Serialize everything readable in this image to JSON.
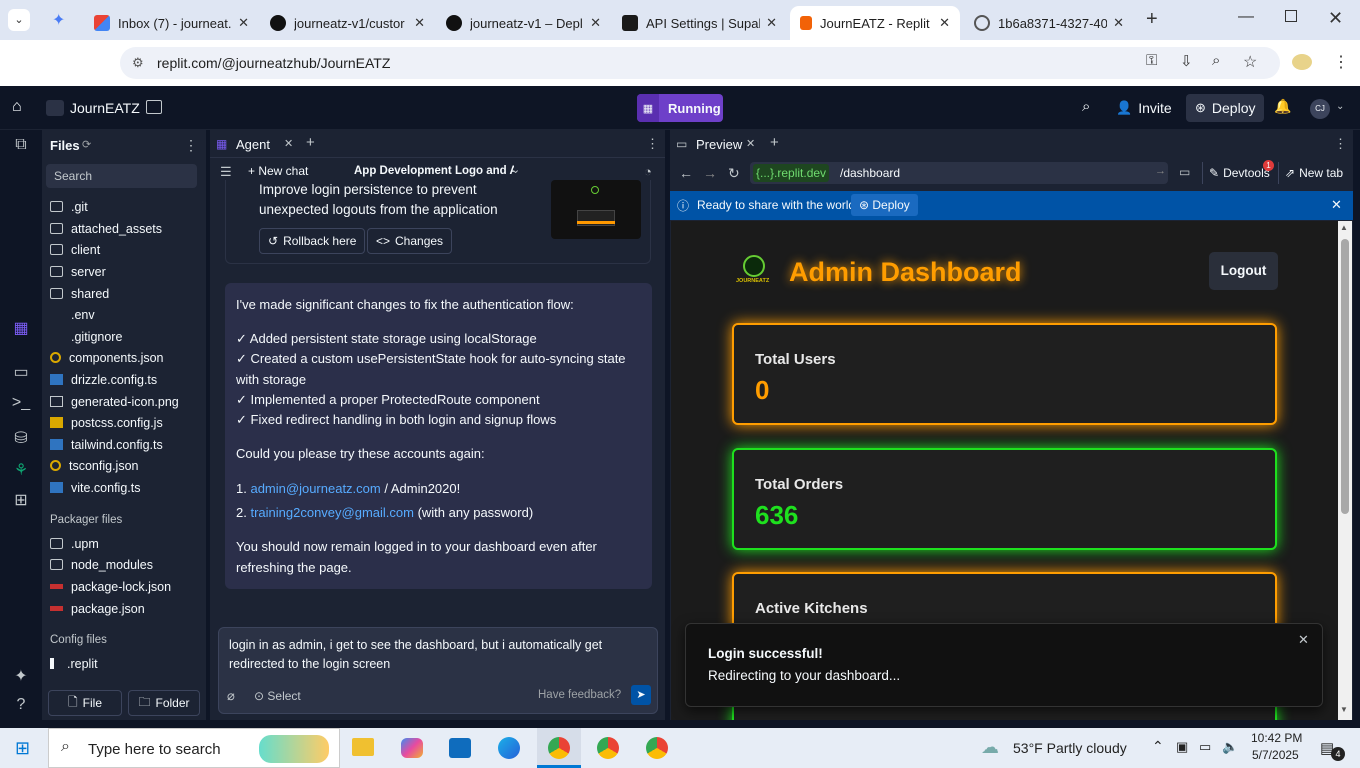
{
  "browser": {
    "tabs": [
      {
        "title": "Inbox (7) - journeat...",
        "icon": "gmail-icon"
      },
      {
        "title": "journeatz-v1/custor",
        "icon": "github-icon"
      },
      {
        "title": "journeatz-v1 – Depl",
        "icon": "vercel-icon"
      },
      {
        "title": "API Settings | Supab",
        "icon": "supabase-icon"
      },
      {
        "title": "JournEATZ - Replit",
        "icon": "replit-icon"
      },
      {
        "title": "1b6a8371-4327-40",
        "icon": "globe-icon"
      }
    ],
    "url": "replit.com/@journeatzhub/JournEATZ"
  },
  "replit": {
    "project_name": "JournEATZ",
    "run_status": "Running",
    "invite_label": "Invite",
    "deploy_label": "Deploy",
    "avatar_initials": "CJ"
  },
  "files": {
    "title": "Files",
    "search_placeholder": "Search",
    "items": [
      ".git",
      "attached_assets",
      "client",
      "server",
      "shared",
      ".env",
      ".gitignore",
      "components.json",
      "drizzle.config.ts",
      "generated-icon.png",
      "postcss.config.js",
      "tailwind.config.ts",
      "tsconfig.json",
      "vite.config.ts"
    ],
    "packager_title": "Packager files",
    "packager_items": [
      ".upm",
      "node_modules",
      "package-lock.json",
      "package.json"
    ],
    "config_title": "Config files",
    "config_items": [
      ".replit"
    ],
    "file_button": "File",
    "folder_button": "Folder"
  },
  "agent": {
    "tab_label": "Agent",
    "new_chat": "New chat",
    "chat_title": "App Development Logo and A...",
    "checkpoint_text": "Improve login persistence to prevent unexpected logouts from the application",
    "rollback_label": "Rollback here",
    "changes_label": "Changes",
    "msg_intro": "I've made significant changes to fix the authentication flow:",
    "msg_points": [
      "✓ Added persistent state storage using localStorage",
      "✓ Created a custom usePersistentState hook for auto-syncing state with storage",
      "✓ Implemented a proper ProtectedRoute component",
      "✓ Fixed redirect handling in both login and signup flows"
    ],
    "msg_ask": "Could you please try these accounts again:",
    "acc1_num": "1.",
    "acc1_email": "admin@journeatz.com",
    "acc1_rest": " / Admin2020!",
    "acc2_num": "2.",
    "acc2_email": "training2convey@gmail.com",
    "acc2_rest": " (with any password)",
    "msg_outro": "You should now remain logged in to your dashboard even after refreshing the page.",
    "input_text": "login in as admin, i get to see the dashboard, but i automatically get redirected to the login screen",
    "select_label": "Select",
    "feedback_label": "Have feedback?"
  },
  "preview": {
    "tab_label": "Preview",
    "domain": "{...}.replit.dev",
    "path": "/dashboard",
    "devtools_label": "Devtools",
    "devtools_badge": "1",
    "newtab_label": "New tab",
    "banner_text": "Ready to share with the world?",
    "banner_deploy": "Deploy"
  },
  "dashboard": {
    "logo_text": "JOURNEATZ",
    "title": "Admin Dashboard",
    "logout": "Logout",
    "cards": [
      {
        "label": "Total Users",
        "value": "0",
        "color": "#ff9d00"
      },
      {
        "label": "Total Orders",
        "value": "636",
        "color": "#1ee01e"
      },
      {
        "label": "Active Kitchens",
        "value": "",
        "color": "#ff9d00"
      }
    ],
    "toast_title": "Login successful!",
    "toast_text": "Redirecting to your dashboard..."
  },
  "taskbar": {
    "search_placeholder": "Type here to search",
    "weather": "53°F  Partly cloudy",
    "time": "10:42 PM",
    "date": "5/7/2025",
    "notif_count": "4"
  }
}
